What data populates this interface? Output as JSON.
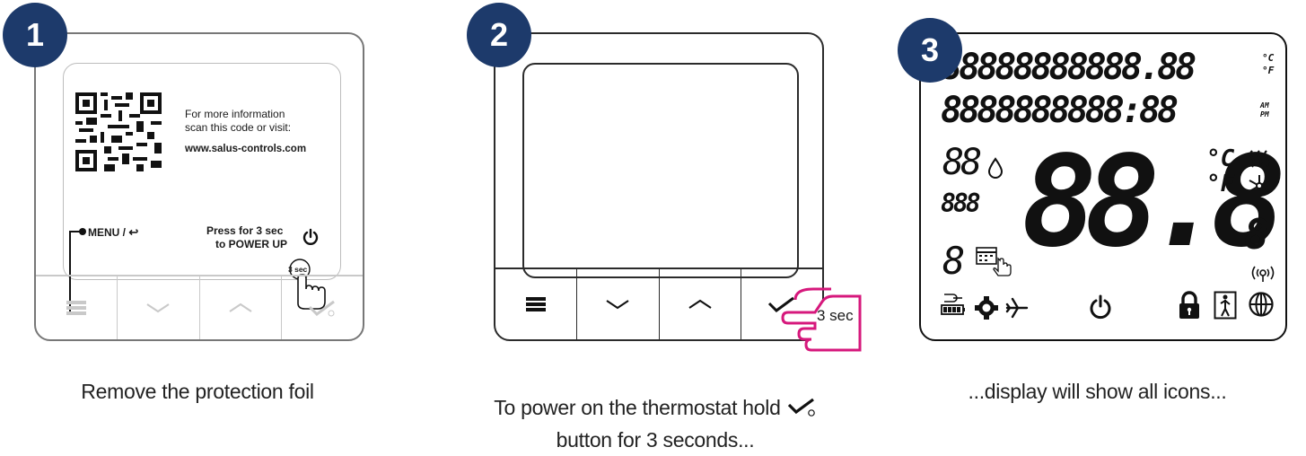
{
  "steps": [
    {
      "number": "1",
      "caption": "Remove the protection foil",
      "qr_text_line1": "For more information",
      "qr_text_line2": "scan this code or visit:",
      "qr_url": "www.salus-controls.com",
      "menu_label": "MENU /",
      "power_line1": "Press for 3 sec",
      "power_line2": "to POWER UP",
      "hold_label": "3 sec"
    },
    {
      "number": "2",
      "caption_line1": "To power on the thermostat hold",
      "caption_line2": "button for 3 seconds...",
      "hold_label": "3 sec"
    },
    {
      "number": "3",
      "caption": "...display will show all icons...",
      "row1": "88888888888.88",
      "row2": "8888888888:88",
      "small_88": "88",
      "small_888": "888",
      "big_digits": "88.8",
      "single_8": "8",
      "unit_c": "°C",
      "unit_f": "°F",
      "unit_c_big": "°C",
      "unit_f_big": "°F",
      "am": "AM",
      "pm": "PM"
    }
  ],
  "colors": {
    "badge": "#1d3a6b",
    "hand_highlight": "#d6187c",
    "outline": "#2b2b2b",
    "foil_grey": "#c9c9c9"
  }
}
